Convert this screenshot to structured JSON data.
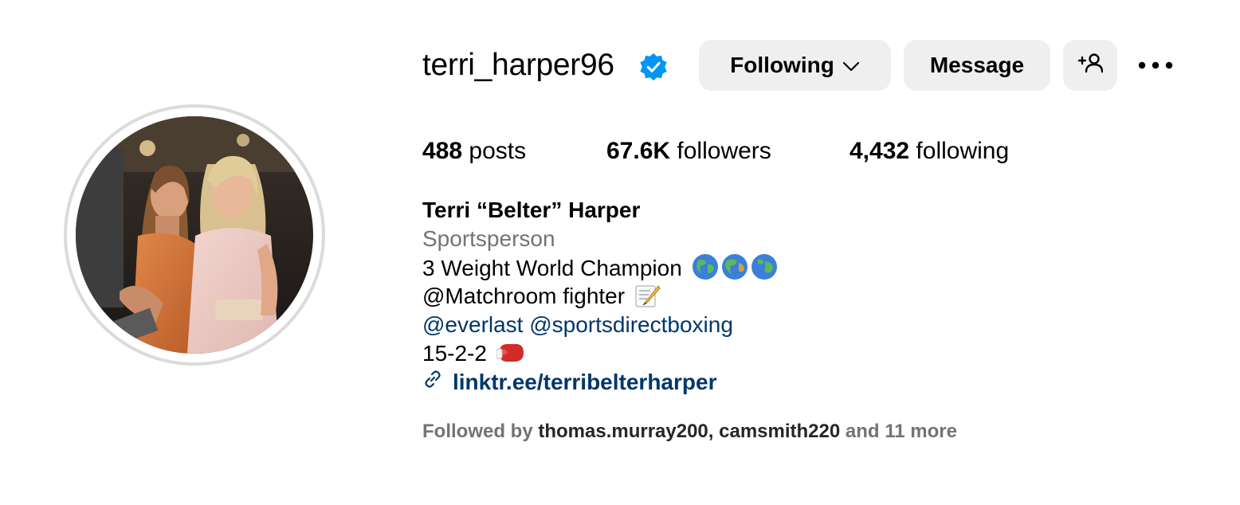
{
  "profile": {
    "username": "terri_harper96",
    "verified": true,
    "full_name": "Terri “Belter” Harper",
    "category": "Sportsperson",
    "bio_line1": "3 Weight World Champion",
    "bio_line2": "@Matchroom fighter",
    "bio_mention1": "@everlast",
    "bio_mention2": "@sportsdirectboxing",
    "bio_record": "15-2-2",
    "link": "linktr.ee/terribelterharper"
  },
  "actions": {
    "following_label": "Following",
    "message_label": "Message"
  },
  "stats": {
    "posts_count": "488",
    "posts_label": "posts",
    "followers_count": "67.6K",
    "followers_label": "followers",
    "following_count": "4,432",
    "following_label": "following"
  },
  "followed_by": {
    "prefix": "Followed by",
    "user1": "thomas.murray200",
    "separator": ",",
    "user2": "camsmith220",
    "suffix": "and 11 more"
  },
  "icons": {
    "verified": "verified-badge-icon",
    "chevron": "chevron-down-icon",
    "add_user": "add-person-icon",
    "more": "more-options-icon",
    "link": "link-icon",
    "globe": "globe-emoji",
    "memo": "memo-emoji",
    "boxing": "boxing-glove-emoji"
  },
  "colors": {
    "verified_blue": "#0095f6",
    "link_blue": "#00376b",
    "button_bg": "#efefef",
    "secondary_text": "#737373"
  }
}
